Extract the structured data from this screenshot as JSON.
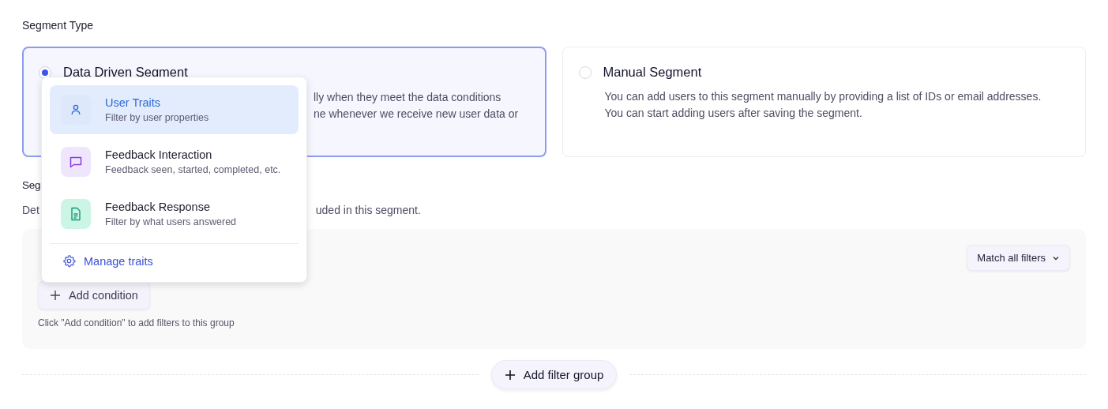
{
  "segment_type": {
    "label": "Segment Type",
    "options": [
      {
        "title": "Data Driven Segment",
        "description_lines": [
          "lly when they meet the data conditions",
          "ne whenever we receive new user data or"
        ],
        "covered": true,
        "selected": true
      },
      {
        "title": "Manual Segment",
        "description_lines": [
          "You can add users to this segment manually by providing a list of IDs or email addresses.",
          "You can start adding users after saving the segment."
        ],
        "covered": false,
        "selected": false
      }
    ]
  },
  "filters": {
    "heading": "Seg",
    "description_parts": [
      "Det",
      "uded in this segment."
    ],
    "group": {
      "match_button": "Match all filters",
      "add_condition": "Add condition",
      "hint": "Click \"Add condition\" to add filters to this group"
    },
    "add_filter_group": "Add filter group"
  },
  "dropdown": {
    "items": [
      {
        "kind": "person",
        "title": "User Traits",
        "subtitle": "Filter by user properties",
        "selected": true
      },
      {
        "kind": "chat",
        "title": "Feedback Interaction",
        "subtitle": "Feedback seen, started, completed, etc.",
        "selected": false
      },
      {
        "kind": "document",
        "title": "Feedback Response",
        "subtitle": "Filter by what users answered",
        "selected": false
      }
    ],
    "footer_link": "Manage traits"
  }
}
